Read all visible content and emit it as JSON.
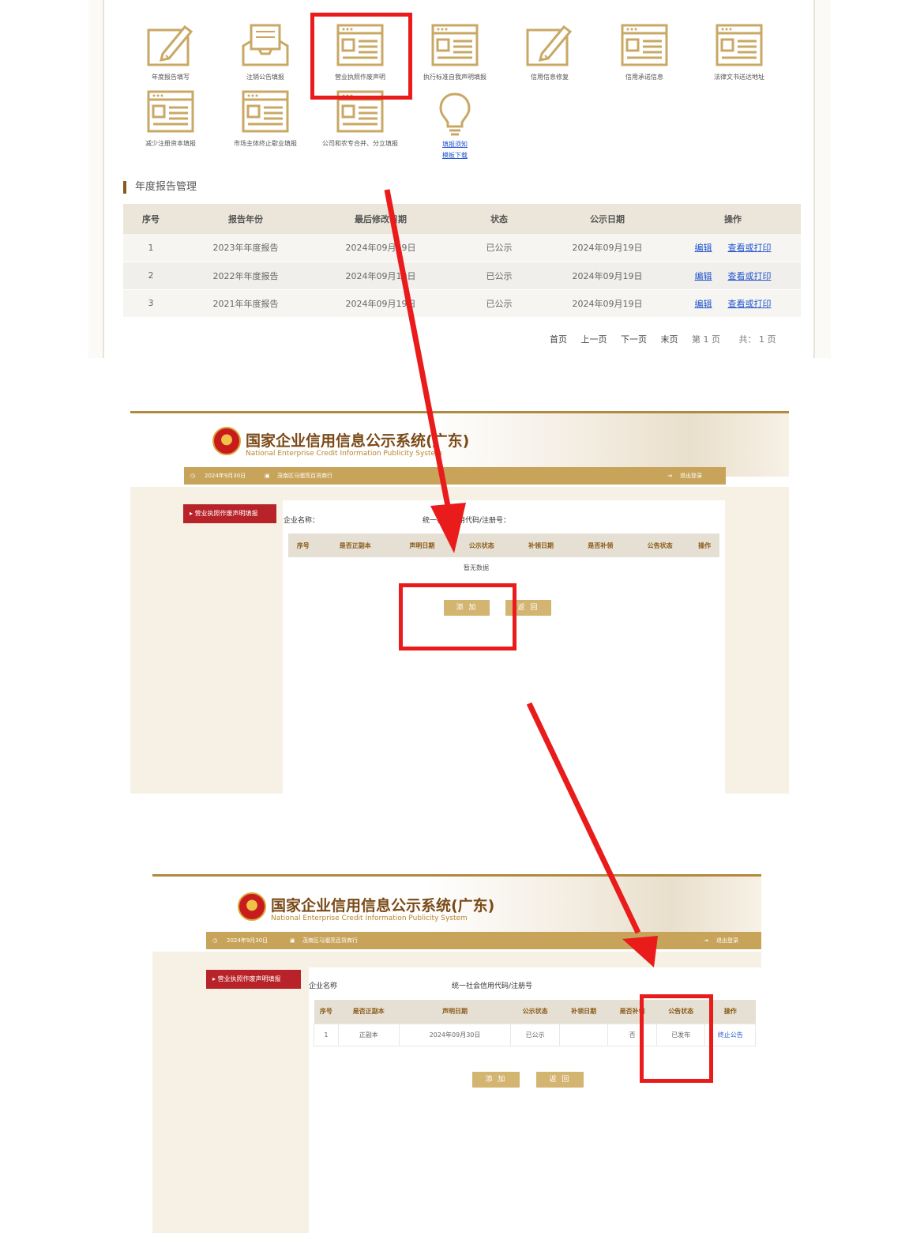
{
  "tiles": [
    {
      "label": "年度报告填写",
      "icon": "edit-icon"
    },
    {
      "label": "注销公告填报",
      "icon": "inbox-icon"
    },
    {
      "label": "营业执照作废声明",
      "icon": "form-icon"
    },
    {
      "label": "执行标准自我声明填报",
      "icon": "form-icon"
    },
    {
      "label": "信用信息修复",
      "icon": "edit-icon"
    },
    {
      "label": "信用承诺信息",
      "icon": "form-icon"
    },
    {
      "label": "法律文书送达地址",
      "icon": "form-icon"
    },
    {
      "label": "减少注册资本填报",
      "icon": "form-icon"
    },
    {
      "label": "市场主体终止歇业填报",
      "icon": "form-icon"
    },
    {
      "label": "公司和农专合并、分立填报",
      "icon": "form-icon"
    }
  ],
  "bulb": {
    "link1": "填报须知",
    "link2": "模板下载"
  },
  "annual": {
    "title": "年度报告管理",
    "headers": [
      "序号",
      "报告年份",
      "最后修改日期",
      "状态",
      "公示日期",
      "操作"
    ],
    "rows": [
      {
        "no": "1",
        "year": "2023年年度报告",
        "modified": "2024年09月19日",
        "status": "已公示",
        "date": "2024年09月19日"
      },
      {
        "no": "2",
        "year": "2022年年度报告",
        "modified": "2024年09月19日",
        "status": "已公示",
        "date": "2024年09月19日"
      },
      {
        "no": "3",
        "year": "2021年年度报告",
        "modified": "2024年09月19日",
        "status": "已公示",
        "date": "2024年09月19日"
      }
    ],
    "edit": "编辑",
    "view": "查看或打印",
    "pager": {
      "first": "首页",
      "prev": "上一页",
      "next": "下一页",
      "last": "末页",
      "page": "第 1 页",
      "total": "共： 1 页"
    }
  },
  "system": {
    "name": "国家企业信用信息公示系统(广东)",
    "name_en": "National Enterprise Credit Information Publicity System",
    "date": "2024年9月30日",
    "store": "茂南区马骝亮百货商行",
    "logout": "退出登录"
  },
  "decl": {
    "side": "▸ 营业执照作废声明填报",
    "company_label": "企业名称：",
    "code_label": "统一社会信用代码/注册号：",
    "company_label2": "企业名称",
    "code_label2": "统一社会信用代码/注册号",
    "headers": [
      "序号",
      "是否正副本",
      "声明日期",
      "公示状态",
      "补领日期",
      "是否补领",
      "公告状态",
      "操作"
    ],
    "empty": "暂无数据",
    "add": "添 加",
    "back": "返 回",
    "row": {
      "no": "1",
      "copy": "正副本",
      "date": "2024年09月30日",
      "pub": "已公示",
      "reissue_date": "",
      "reissue": "否",
      "notice": "已发布",
      "op": "终止公告"
    }
  },
  "colors": {
    "accent": "#c8a35a",
    "brand": "#7a4a18",
    "annotation": "#ea1b1b"
  }
}
